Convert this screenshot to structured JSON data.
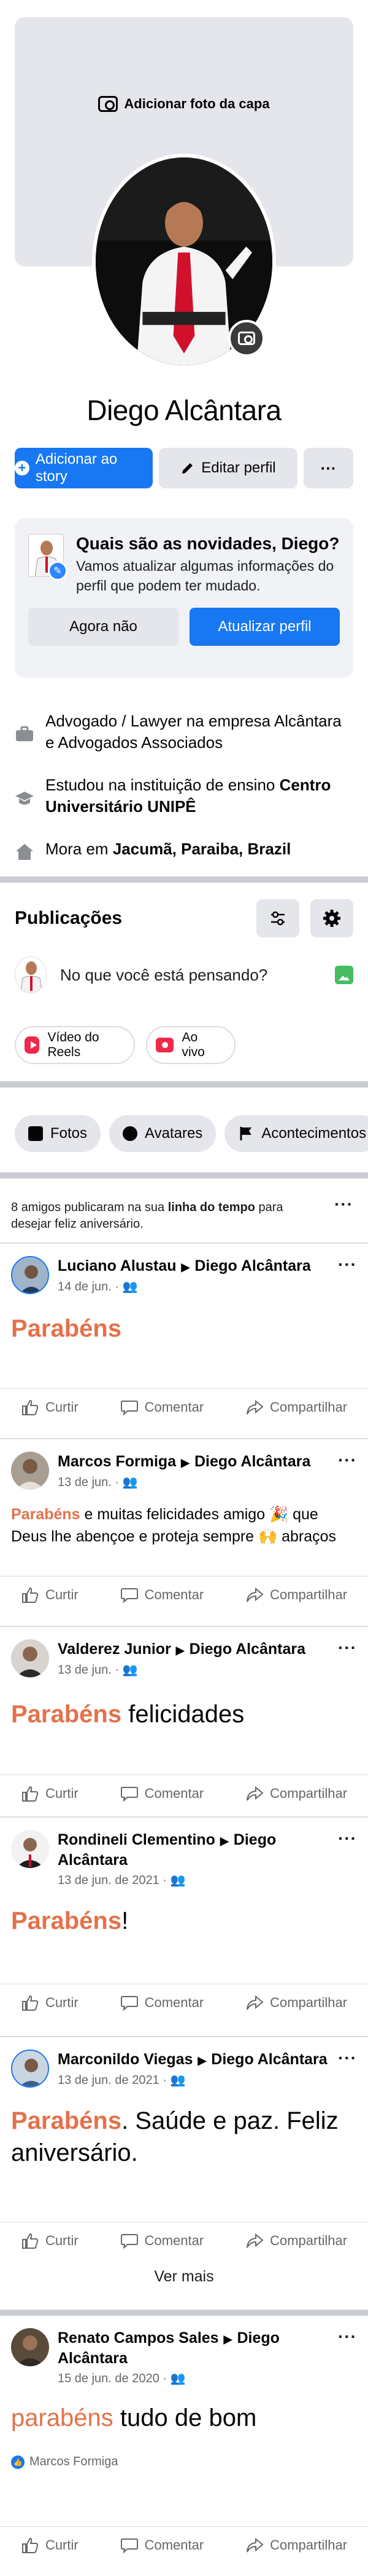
{
  "profile": {
    "add_cover": "Adicionar foto da capa",
    "name": "Diego Alcântara",
    "add_story": "Adicionar ao story",
    "edit_profile": "Editar perfil",
    "more": "···"
  },
  "update_card": {
    "title": "Quais são as novidades, Diego?",
    "description": "Vamos atualizar algumas informações do perfil que podem ter mudado.",
    "not_now": "Agora não",
    "update": "Atualizar perfil"
  },
  "intro": {
    "work": "Advogado / Lawyer na empresa Alcântara e Advogados Associados",
    "study_prefix": "Estudou na instituição de ensino ",
    "study_bold": "Centro Universitário UNIPÊ",
    "home_prefix": "Mora em ",
    "home_bold": "Jacumã, Paraiba, Brazil"
  },
  "publications": {
    "title": "Publicações",
    "composer": "No que você está pensando?",
    "reels": "Vídeo do Reels",
    "live": "Ao vivo"
  },
  "filters": [
    "Fotos",
    "Avatares",
    "Acontecimentos"
  ],
  "birthday": {
    "prefix": "8 amigos publicaram na sua ",
    "bold": "linha do tempo",
    "suffix": " para desejar feliz aniversário."
  },
  "actions": {
    "like": "Curtir",
    "comment": "Comentar",
    "share": "Compartilhar"
  },
  "posts": [
    {
      "author": "Luciano Alustau",
      "target": "Diego Alcântara",
      "date": "14 de jun.",
      "hl": "Parabéns",
      "rest": ""
    },
    {
      "author": "Marcos Formiga",
      "target": "Diego Alcântara",
      "date": "13 de jun.",
      "hl": "Parabéns",
      "rest": " e muitas felicidades amigo 🎉 que Deus lhe abençoe e proteja sempre 🙌 abraços"
    },
    {
      "author": "Valderez Junior",
      "target": "Diego Alcântara",
      "date": "13 de jun.",
      "hl": "Parabéns",
      "rest": " felicidades"
    },
    {
      "author": "Rondineli Clementino",
      "target": "Diego Alcântara",
      "date": "13 de jun. de 2021",
      "hl": "Parabéns",
      "rest": "!"
    },
    {
      "author": "Marconildo Viegas",
      "target": "Diego Alcântara",
      "date": "13 de jun. de 2021",
      "hl": "Parabéns",
      "rest": ". Saúde e paz. Feliz aniversário."
    },
    {
      "author": "Renato Campos Sales",
      "target": "Diego Alcântara",
      "date": "15 de jun. de 2020",
      "hl": "parabéns",
      "rest": " tudo de bom",
      "reaction": "Marcos Formiga"
    }
  ],
  "see_more": "Ver mais",
  "colors": {
    "accent": "#1877f2",
    "highlight": "#e4714a",
    "surface": "#e4e6eb"
  }
}
